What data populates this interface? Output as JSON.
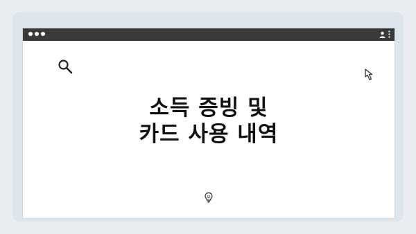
{
  "slide": {
    "heading_line1": "소득 증빙 및",
    "heading_line2": "카드 사용 내역"
  },
  "icons": {
    "search": "search-icon",
    "cursor": "cursor-arrow-icon",
    "bulb": "lightbulb-icon",
    "user": "user-icon",
    "menu": "kebab-menu-icon"
  },
  "colors": {
    "background": "#e9edf2",
    "titlebar": "#3a3a3a",
    "heading": "#111111"
  }
}
